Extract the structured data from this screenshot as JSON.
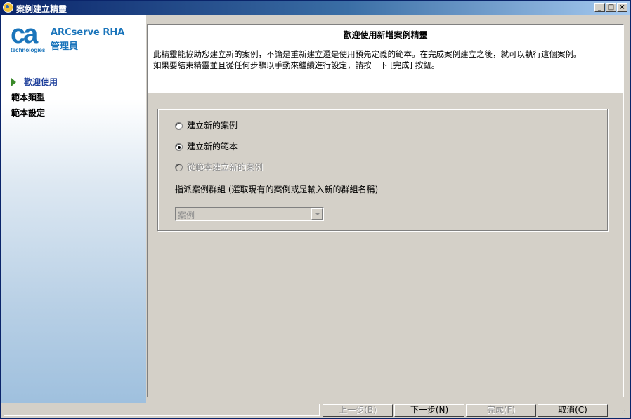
{
  "window": {
    "title": "案例建立精靈",
    "controls": {
      "minimize": "_",
      "maximize": "□",
      "close": "×"
    }
  },
  "brand": {
    "logo_mark": "ca",
    "logo_sub": "technologies",
    "product_name": "ARCserve RHA",
    "product_sub": "管理員",
    "accent_color": "#1b75bb"
  },
  "steps": [
    {
      "label": "歡迎使用",
      "active": true
    },
    {
      "label": "範本類型",
      "active": false
    },
    {
      "label": "範本設定",
      "active": false
    }
  ],
  "header": {
    "title": "歡迎使用新增案例精靈",
    "description_line1": "此精靈能協助您建立新的案例，不論是重新建立還是使用預先定義的範本。在完成案例建立之後，就可以執行這個案例。",
    "description_line2": "如果要結束精靈並且從任何步驟以手動來繼續進行設定，請按一下 [完成] 按鈕。"
  },
  "options": [
    {
      "label": "建立新的案例",
      "checked": false,
      "disabled": false
    },
    {
      "label": "建立新的範本",
      "checked": true,
      "disabled": false
    },
    {
      "label": "從範本建立新的案例",
      "checked": false,
      "disabled": true
    }
  ],
  "group": {
    "label": "指派案例群組 (選取現有的案例或是輸入新的群組名稱)",
    "combo_value": "案例"
  },
  "buttons": {
    "back": "上一步(B)",
    "next": "下一步(N)",
    "finish": "完成(F)",
    "cancel": "取消(C)"
  }
}
